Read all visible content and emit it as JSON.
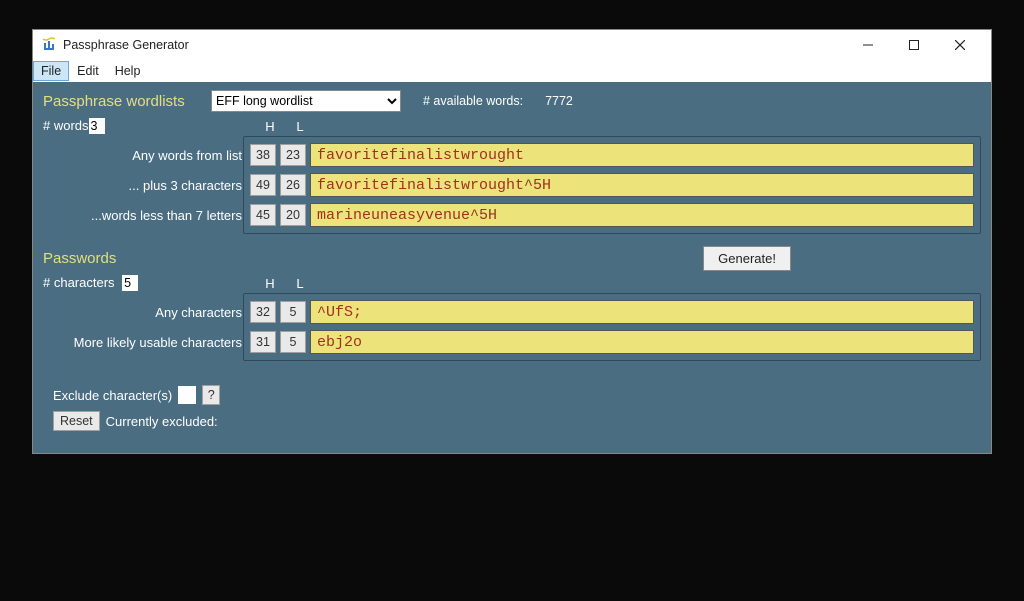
{
  "window": {
    "title": "Passphrase Generator"
  },
  "menu": {
    "file": "File",
    "edit": "Edit",
    "help": "Help"
  },
  "top": {
    "section_label": "Passphrase wordlists",
    "wordlist_selected": "EFF long wordlist",
    "available_label": "# available words:",
    "available_value": "7772"
  },
  "words": {
    "count_label": "# words",
    "count_value": "3",
    "h_header": "H",
    "l_header": "L",
    "rows": [
      {
        "label": "Any words from list",
        "h": "38",
        "l": "23",
        "text": "favoritefinalistwrought"
      },
      {
        "label": "... plus 3 characters",
        "h": "49",
        "l": "26",
        "text": "favoritefinalistwrought^5H"
      },
      {
        "label": "...words less than 7 letters",
        "h": "45",
        "l": "20",
        "text": "marineuneasyvenue^5H"
      }
    ]
  },
  "generate": {
    "label": "Generate!"
  },
  "passwords": {
    "section_label": "Passwords",
    "count_label": "# characters",
    "count_value": "5",
    "h_header": "H",
    "l_header": "L",
    "rows": [
      {
        "label": "Any characters",
        "h": "32",
        "l": "5",
        "text": "^UfS;"
      },
      {
        "label": "More likely usable characters",
        "h": "31",
        "l": "5",
        "text": "ebj2o"
      }
    ]
  },
  "exclude": {
    "label": "Exclude character(s)",
    "q": "?",
    "reset": "Reset",
    "current_label": "Currently excluded:"
  }
}
